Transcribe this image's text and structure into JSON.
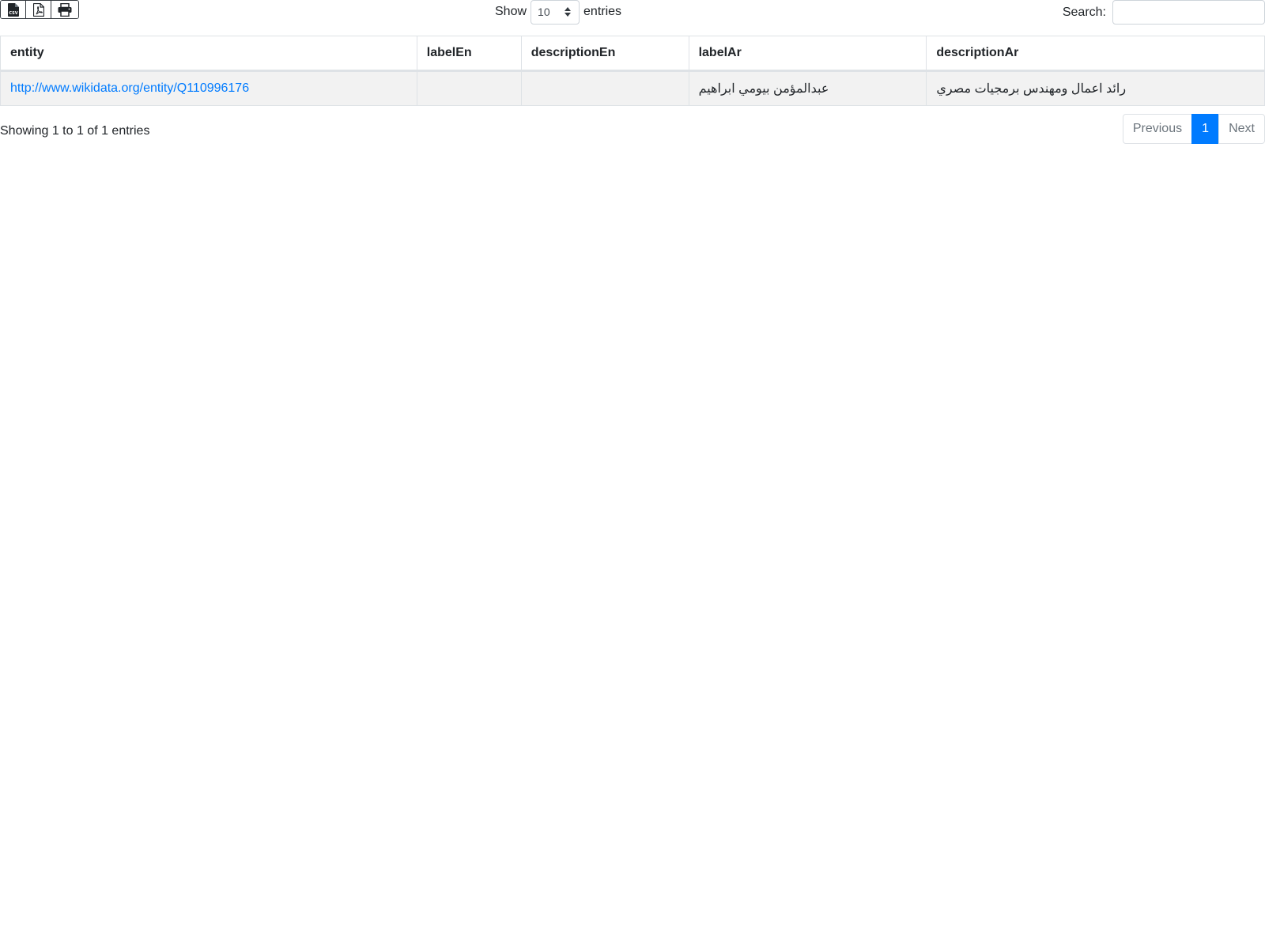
{
  "toolbar": {
    "export_buttons": [
      {
        "icon": "csv-file-icon"
      },
      {
        "icon": "pdf-file-icon"
      },
      {
        "icon": "print-icon"
      }
    ],
    "length": {
      "prefix": "Show",
      "value": "10",
      "suffix": "entries"
    },
    "search": {
      "label": "Search:",
      "value": ""
    }
  },
  "table": {
    "columns": [
      "entity",
      "labelEn",
      "descriptionEn",
      "labelAr",
      "descriptionAr"
    ],
    "rows": [
      {
        "entity": "http://www.wikidata.org/entity/Q110996176",
        "labelEn": "",
        "descriptionEn": "",
        "labelAr": "عبدالمؤمن بيومي ابراهيم",
        "descriptionAr": "رائد اعمال ومهندس برمجيات مصري"
      }
    ]
  },
  "footer": {
    "info": "Showing 1 to 1 of 1 entries",
    "pagination": {
      "previous": "Previous",
      "current": "1",
      "next": "Next"
    }
  },
  "colors": {
    "accent": "#007bff",
    "row_background": "#f2f2f2",
    "border": "#dee2e6"
  }
}
